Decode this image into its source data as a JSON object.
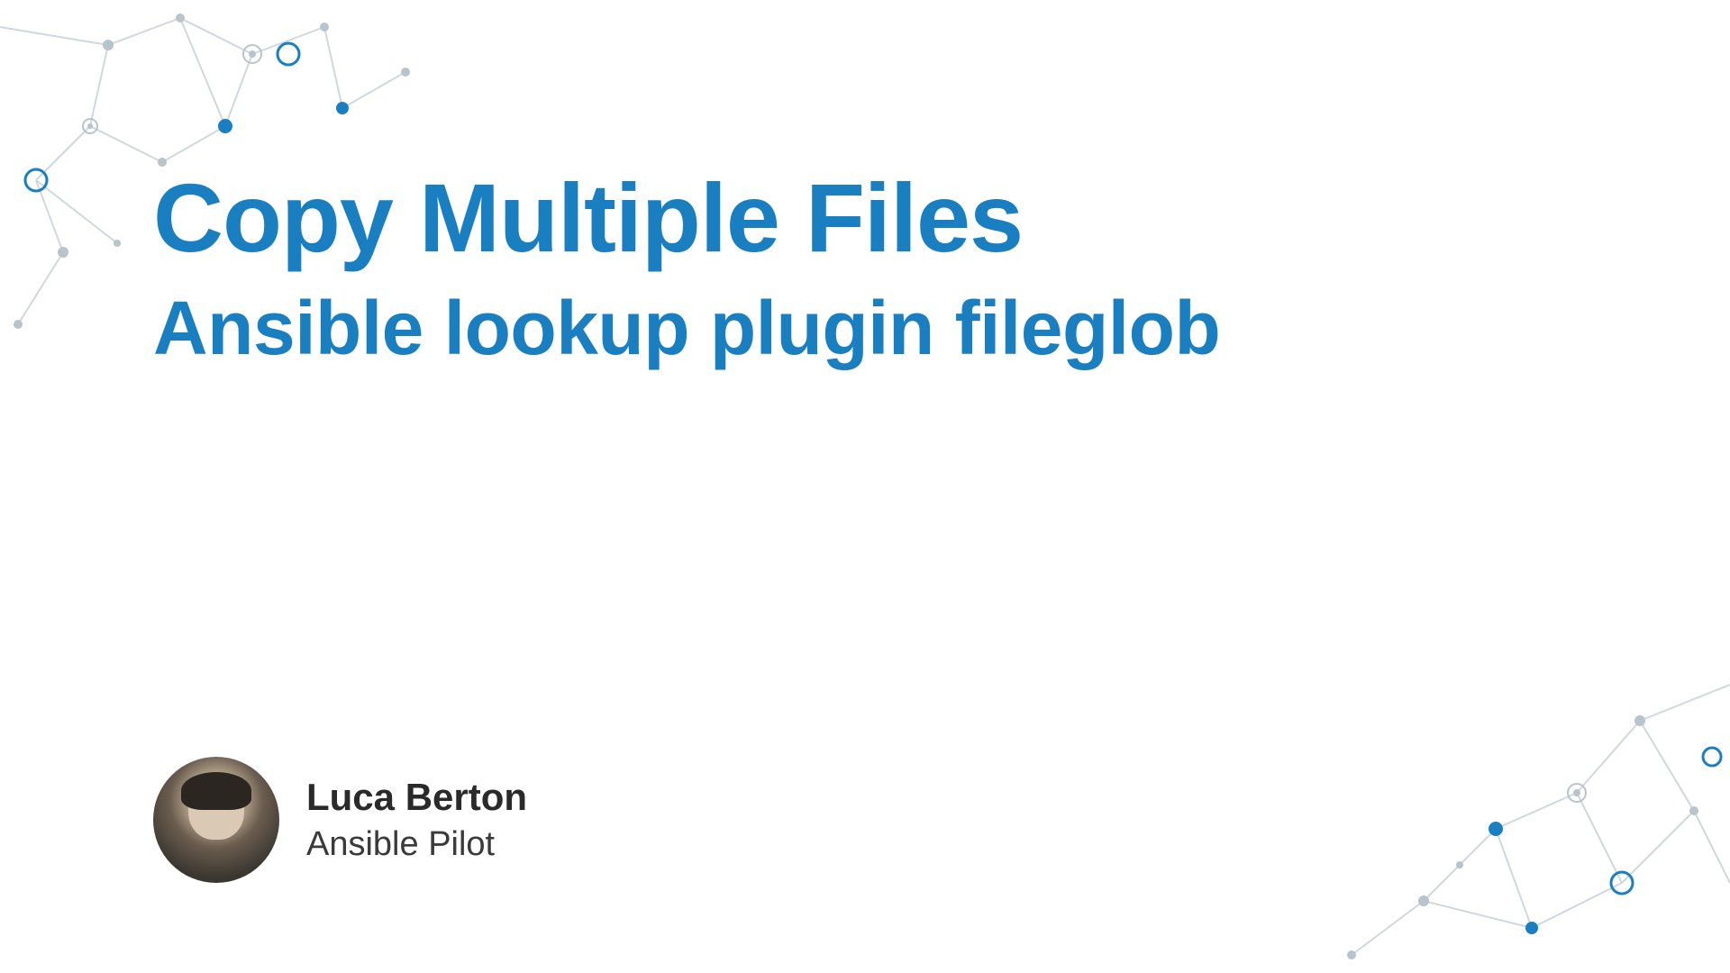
{
  "slide": {
    "title": "Copy Multiple Files",
    "subtitle": "Ansible lookup plugin fileglob"
  },
  "author": {
    "name": "Luca Berton",
    "role": "Ansible Pilot"
  },
  "colors": {
    "accent": "#1a7fc1",
    "text_dark": "#2a2a2a",
    "text_medium": "#3a3a3a",
    "node_gray": "#b8c4cc",
    "line_gray": "#d0d8de"
  }
}
